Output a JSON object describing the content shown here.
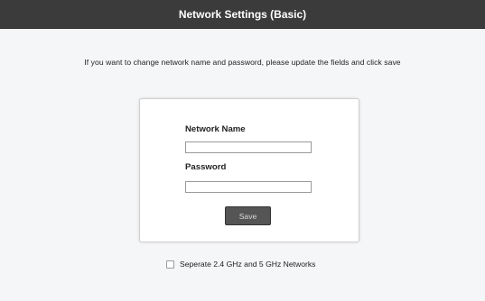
{
  "header": {
    "title": "Network Settings (Basic)"
  },
  "instructions": "If you want to change network name and password, please update the fields and click save",
  "form": {
    "network_name_label": "Network Name",
    "network_name_value": "",
    "password_label": "Password",
    "password_value": "",
    "save_label": "Save"
  },
  "separate": {
    "label": "Seperate 2.4 GHz and 5 GHz Networks",
    "checked": false
  }
}
